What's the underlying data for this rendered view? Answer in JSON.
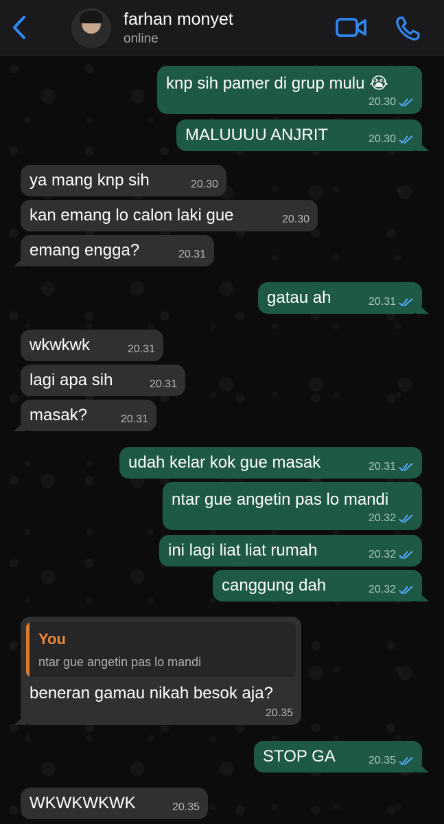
{
  "header": {
    "contact_name": "farhan monyet",
    "status": "online",
    "back_icon": "chevron-left-icon",
    "video_icon": "video-camera-icon",
    "phone_icon": "phone-icon",
    "accent_color": "#2f8cff"
  },
  "messages": [
    {
      "dir": "out",
      "text": "knp sih pamer di grup mulu 😭",
      "time": "20.30"
    },
    {
      "dir": "out",
      "text": "MALUUUU ANJRIT",
      "time": "20.30"
    },
    {
      "dir": "in",
      "text": "ya mang knp sih",
      "time": "20.30"
    },
    {
      "dir": "in",
      "text": "kan emang lo calon laki gue",
      "time": "20.30"
    },
    {
      "dir": "in",
      "text": "emang engga?",
      "time": "20.31"
    },
    {
      "dir": "out",
      "text": "gatau ah",
      "time": "20.31"
    },
    {
      "dir": "in",
      "text": "wkwkwk",
      "time": "20.31"
    },
    {
      "dir": "in",
      "text": "lagi apa sih",
      "time": "20.31"
    },
    {
      "dir": "in",
      "text": "masak?",
      "time": "20.31"
    },
    {
      "dir": "out",
      "text": "udah kelar kok gue masak",
      "time": "20.31"
    },
    {
      "dir": "out",
      "text": "ntar gue angetin pas lo mandi",
      "time": "20.32"
    },
    {
      "dir": "out",
      "text": "ini lagi liat liat rumah",
      "time": "20.32"
    },
    {
      "dir": "out",
      "text": "canggung dah",
      "time": "20.32"
    },
    {
      "dir": "in",
      "text": "beneran gamau nikah besok aja?",
      "time": "20.35",
      "quote_author": "You",
      "quote_text": "ntar gue angetin pas lo mandi"
    },
    {
      "dir": "out",
      "text": "STOP GA",
      "time": "20.35"
    },
    {
      "dir": "in",
      "text": "WKWKWKWK",
      "time": "20.35"
    }
  ]
}
